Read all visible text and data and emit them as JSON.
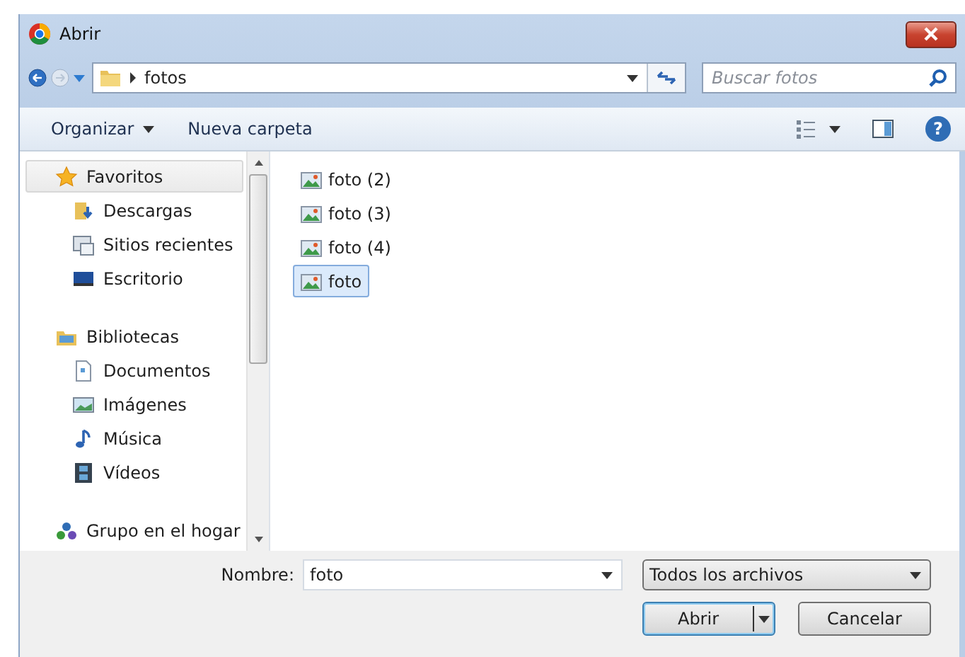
{
  "window": {
    "title": "Abrir"
  },
  "address": {
    "path": "fotos"
  },
  "search": {
    "placeholder": "Buscar fotos"
  },
  "toolbar": {
    "organize": "Organizar",
    "new_folder": "Nueva carpeta",
    "help": "?"
  },
  "sidebar": {
    "groups": [
      {
        "label": "Favoritos",
        "kind": "star",
        "selected": true,
        "children": [
          {
            "label": "Descargas",
            "kind": "download",
            "selected": false
          },
          {
            "label": "Sitios recientes",
            "kind": "recent",
            "selected": false
          },
          {
            "label": "Escritorio",
            "kind": "desktop",
            "selected": false
          }
        ]
      },
      {
        "label": "Bibliotecas",
        "kind": "library",
        "selected": false,
        "children": [
          {
            "label": "Documentos",
            "kind": "document",
            "selected": false
          },
          {
            "label": "Imágenes",
            "kind": "picture",
            "selected": false
          },
          {
            "label": "Música",
            "kind": "music",
            "selected": false
          },
          {
            "label": "Vídeos",
            "kind": "video",
            "selected": false
          }
        ]
      },
      {
        "label": "Grupo en el hogar",
        "kind": "homegroup",
        "selected": false
      }
    ]
  },
  "files": [
    {
      "name": "foto (2)",
      "selected": false
    },
    {
      "name": "foto (3)",
      "selected": false
    },
    {
      "name": "foto (4)",
      "selected": false
    },
    {
      "name": "foto",
      "selected": true
    }
  ],
  "filename": {
    "label": "Nombre:",
    "value": "foto"
  },
  "filter": {
    "value": "Todos los archivos"
  },
  "buttons": {
    "open": "Abrir",
    "cancel": "Cancelar"
  }
}
